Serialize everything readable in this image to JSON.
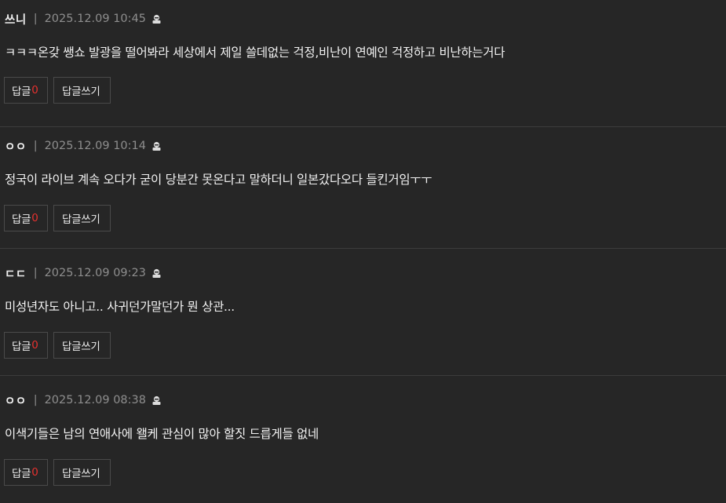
{
  "comments": [
    {
      "author": "쓰니",
      "separator": "|",
      "date": "2025.12.09 10:45",
      "body": "ㅋㅋㅋ온갖 쌩쇼 발광을 떨어봐라 세상에서 제일 쓸데없는 걱정,비난이 연예인 걱정하고 비난하는거다",
      "reply_label": "답글",
      "reply_count": "0",
      "write_reply_label": "답글쓰기"
    },
    {
      "author": "ㅇㅇ",
      "separator": "|",
      "date": "2025.12.09 10:14",
      "body": "정국이 라이브 계속 오다가 굳이 당분간 못온다고 말하더니 일본갔다오다 들킨거임ㅜㅜ",
      "reply_label": "답글",
      "reply_count": "0",
      "write_reply_label": "답글쓰기"
    },
    {
      "author": "ㄷㄷ",
      "separator": "|",
      "date": "2025.12.09 09:23",
      "body": "미성년자도 아니고.. 사귀던가말던가 뭔 상관...",
      "reply_label": "답글",
      "reply_count": "0",
      "write_reply_label": "답글쓰기"
    },
    {
      "author": "ㅇㅇ",
      "separator": "|",
      "date": "2025.12.09 08:38",
      "body": "이색기들은 남의 연애사에 왤케 관심이 많아 할짓 드릅게들 없네",
      "reply_label": "답글",
      "reply_count": "0",
      "write_reply_label": "답글쓰기"
    }
  ],
  "colors": {
    "background": "#262626",
    "divider": "#3c3c3c",
    "reply_count": "#e8312f",
    "date": "#8e8e8e"
  },
  "icons": {
    "anonymous": "user-lock-icon"
  }
}
